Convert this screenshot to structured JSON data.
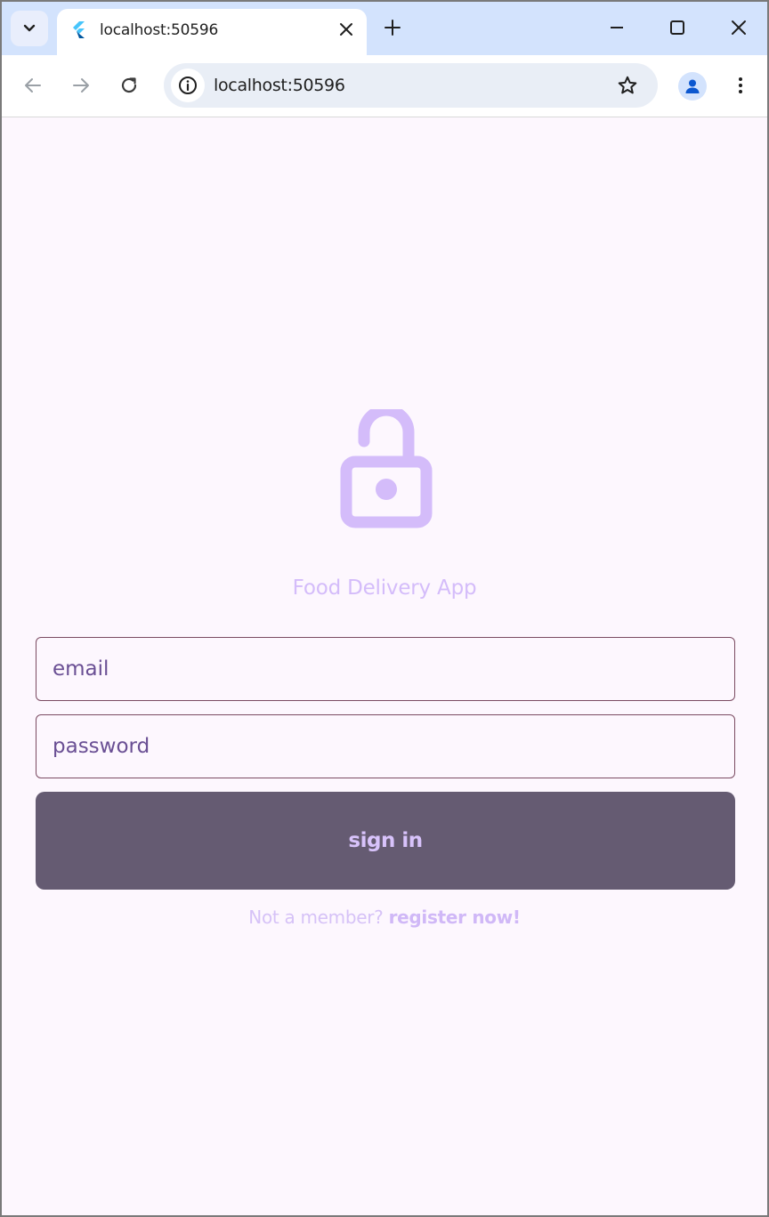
{
  "browser": {
    "tab": {
      "title": "localhost:50596"
    },
    "address_bar": {
      "url": "localhost:50596"
    }
  },
  "icons": {
    "tab_search": "chevron-down-icon",
    "favicon": "flutter-icon",
    "tab_close": "close-icon",
    "new_tab": "plus-icon",
    "minimize": "minimize-icon",
    "maximize": "maximize-icon",
    "close_window": "close-icon",
    "back": "arrow-left-icon",
    "forward": "arrow-right-icon",
    "reload": "reload-icon",
    "site_info": "info-icon",
    "bookmark": "star-icon",
    "profile": "person-icon",
    "menu": "kebab-icon",
    "hero": "lock-open-icon"
  },
  "app": {
    "title": "Food Delivery App",
    "email_placeholder": "email",
    "password_placeholder": "password",
    "signin_label": "sign in",
    "register_prompt": "Not a member?",
    "register_link": "register now!"
  },
  "colors": {
    "page_background": "#fdf7fe",
    "accent_light": "#d4bcfa",
    "button_background": "#655b72",
    "field_border": "#7b4b62",
    "field_text": "#6a4f94",
    "tabstrip": "#d3e3fd"
  }
}
